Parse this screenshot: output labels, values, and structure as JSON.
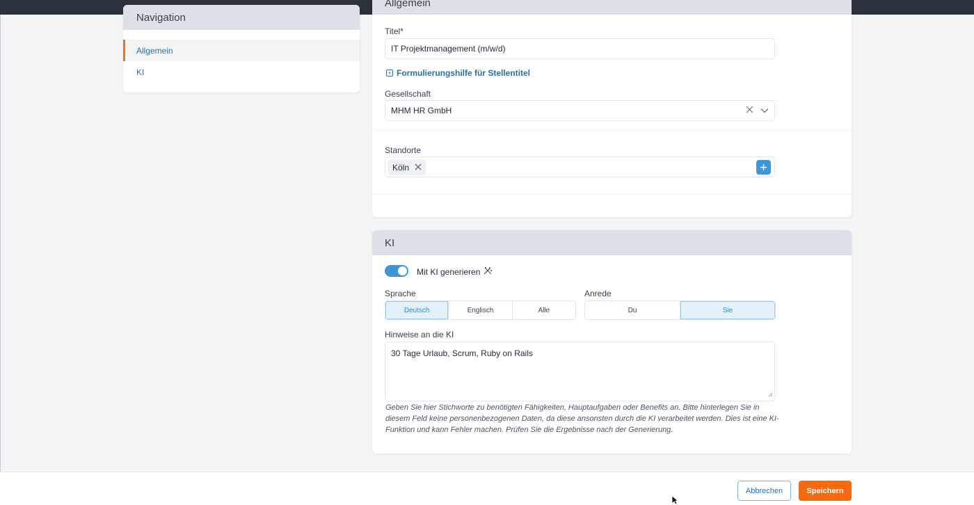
{
  "navigation": {
    "title": "Navigation",
    "items": [
      {
        "label": "Allgemein",
        "active": true
      },
      {
        "label": "KI",
        "active": false
      }
    ]
  },
  "general": {
    "title": "Allgemein",
    "title_label": "Titel*",
    "title_value": "IT Projektmanagement (m/w/d)",
    "helper_link": "Formulierungshilfe für Stellentitel",
    "company_label": "Gesellschaft",
    "company_value": "MHM HR GmbH",
    "locations_label": "Standorte",
    "locations": [
      "Köln"
    ]
  },
  "ki": {
    "title": "KI",
    "toggle_label": "Mit KI generieren",
    "toggle_on": true,
    "language_label": "Sprache",
    "language_options": [
      "Deutsch",
      "Englisch",
      "Alle"
    ],
    "language_selected": "Deutsch",
    "salutation_label": "Anrede",
    "salutation_options": [
      "Du",
      "Sie"
    ],
    "salutation_selected": "Sie",
    "notes_label": "Hinweise an die KI",
    "notes_value": "30 Tage Urlaub, Scrum, Ruby on Rails",
    "hint": "Geben Sie hier Stichworte zu benötigten Fähigkeiten, Hauptaufgaben oder Benefits an. Bitte hinterlegen Sie in diesem Feld keine personenbezogenen Daten, da diese ansonsten durch die KI verarbeitet werden. Dies ist eine KI-Funktion und kann Fehler machen. Prüfen Sie die Ergebnisse nach der Generierung."
  },
  "footer": {
    "cancel_label": "Abbrechen",
    "save_label": "Speichern"
  },
  "colors": {
    "accent": "#3d96d6",
    "save": "#f26b10",
    "active_marker": "#e8742a",
    "link": "#2a6fa8"
  }
}
